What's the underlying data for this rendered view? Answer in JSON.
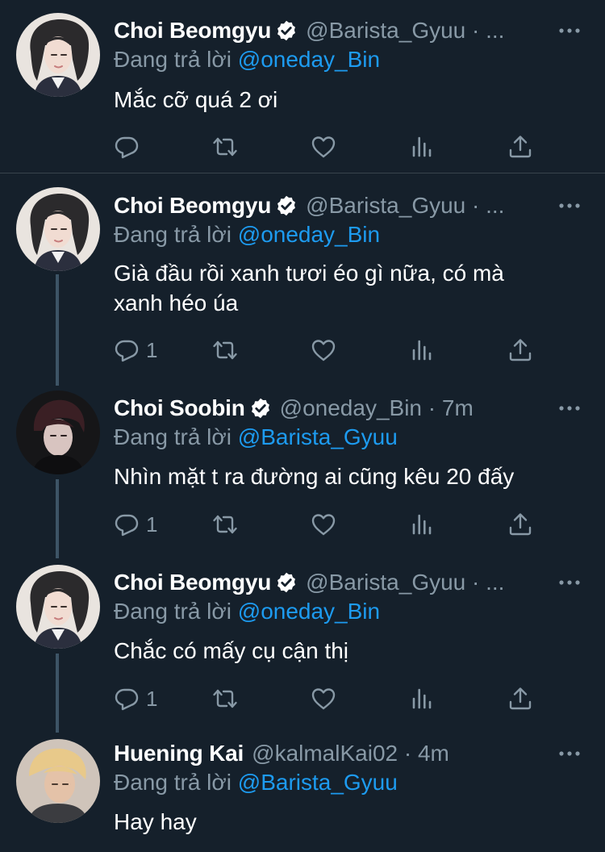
{
  "tweets": [
    {
      "name": "Choi Beomgyu",
      "verified": true,
      "handle": "@Barista_Gyuu · ...",
      "replying_prefix": "Đang trả lời",
      "replying_to": "@oneday_Bin",
      "text": "Mắc cỡ quá 2 ơi",
      "reply_count": ""
    },
    {
      "name": "Choi Beomgyu",
      "verified": true,
      "handle": "@Barista_Gyuu · ...",
      "replying_prefix": "Đang trả lời",
      "replying_to": "@oneday_Bin",
      "text": "Già đầu rồi xanh tươi éo gì nữa, có mà xanh héo úa",
      "reply_count": "1"
    },
    {
      "name": "Choi Soobin",
      "verified": true,
      "handle": "@oneday_Bin · 7m",
      "replying_prefix": "Đang trả lời",
      "replying_to": "@Barista_Gyuu",
      "text": "Nhìn mặt t ra đường ai cũng kêu 20 đấy",
      "reply_count": "1"
    },
    {
      "name": "Choi Beomgyu",
      "verified": true,
      "handle": "@Barista_Gyuu · ...",
      "replying_prefix": "Đang trả lời",
      "replying_to": "@oneday_Bin",
      "text": "Chắc có mấy cụ cận thị",
      "reply_count": "1"
    },
    {
      "name": "Huening Kai",
      "verified": false,
      "handle": "@kalmalKai02 · 4m",
      "replying_prefix": "Đang trả lời",
      "replying_to": "@Barista_Gyuu",
      "text": "Hay hay",
      "reply_count": ""
    }
  ],
  "icons": {
    "reply": "reply-icon",
    "retweet": "retweet-icon",
    "like": "heart-icon",
    "stats": "stats-icon",
    "share": "share-icon",
    "more": "more-icon",
    "verified": "verified-badge-icon"
  },
  "colors": {
    "background": "#15202b",
    "text": "#ffffff",
    "secondary": "#8899a6",
    "link": "#1d9bf0",
    "thread_line": "#3d5466"
  }
}
